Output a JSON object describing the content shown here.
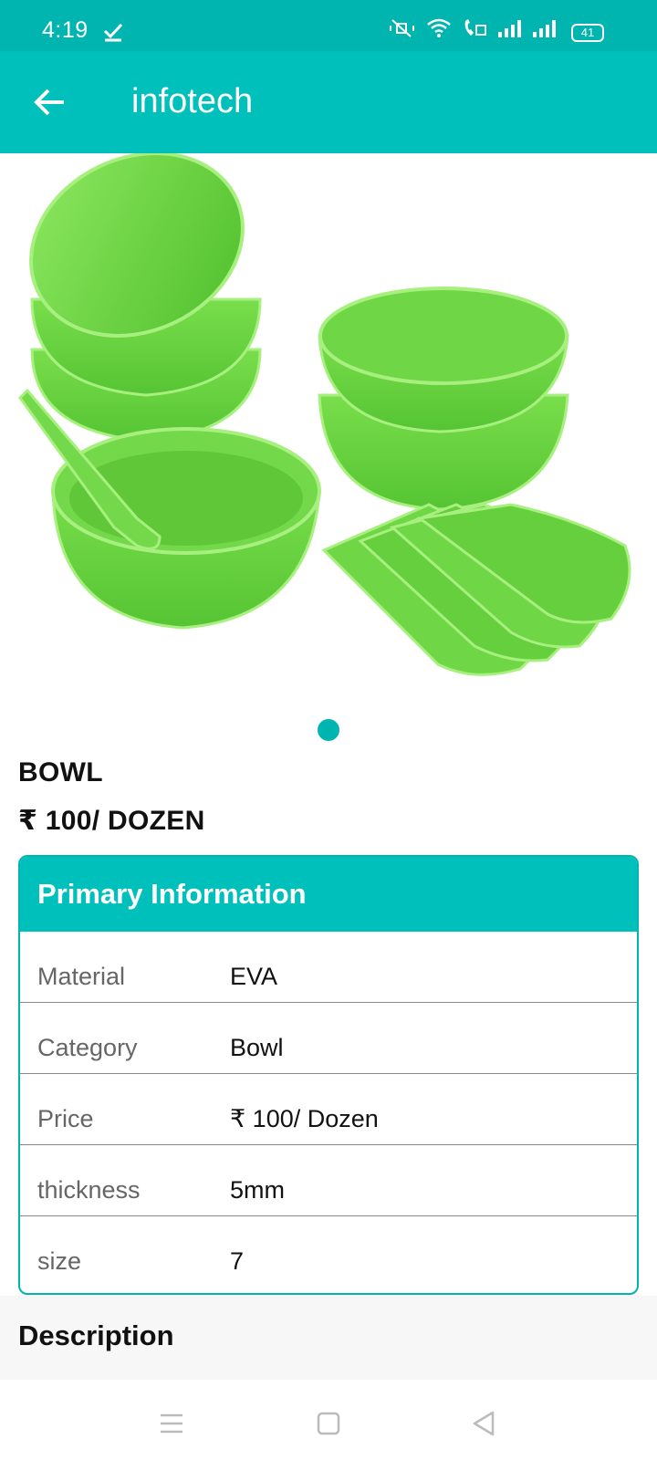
{
  "status_bar": {
    "time": "4:19",
    "battery": "41",
    "icons": [
      "check-icon",
      "mute-vibrate-icon",
      "wifi-icon",
      "wifi-calling-icon",
      "signal-icon",
      "signal-icon",
      "battery-icon"
    ]
  },
  "app_bar": {
    "title": "infotech",
    "back_icon": "arrow-left-icon"
  },
  "gallery": {
    "image": "green bowls and spoons",
    "page_indicator": {
      "count": 1,
      "active": 1
    }
  },
  "product": {
    "name": "BOWL",
    "price": "₹ 100/ DOZEN"
  },
  "primary_info": {
    "header": "Primary Information",
    "rows": [
      {
        "label": "Material",
        "value": "EVA"
      },
      {
        "label": "Category",
        "value": "Bowl"
      },
      {
        "label": "Price",
        "value": "₹ 100/ Dozen"
      },
      {
        "label": "thickness",
        "value": "5mm"
      },
      {
        "label": "size",
        "value": "7"
      }
    ]
  },
  "description": {
    "title": "Description"
  },
  "nav_bar": {
    "buttons": [
      "menu-icon",
      "home-square-icon",
      "back-triangle-icon"
    ]
  },
  "colors": {
    "accent": "#00c0bb",
    "status_bar": "#00b5b0",
    "product_green": "#6fd645"
  }
}
